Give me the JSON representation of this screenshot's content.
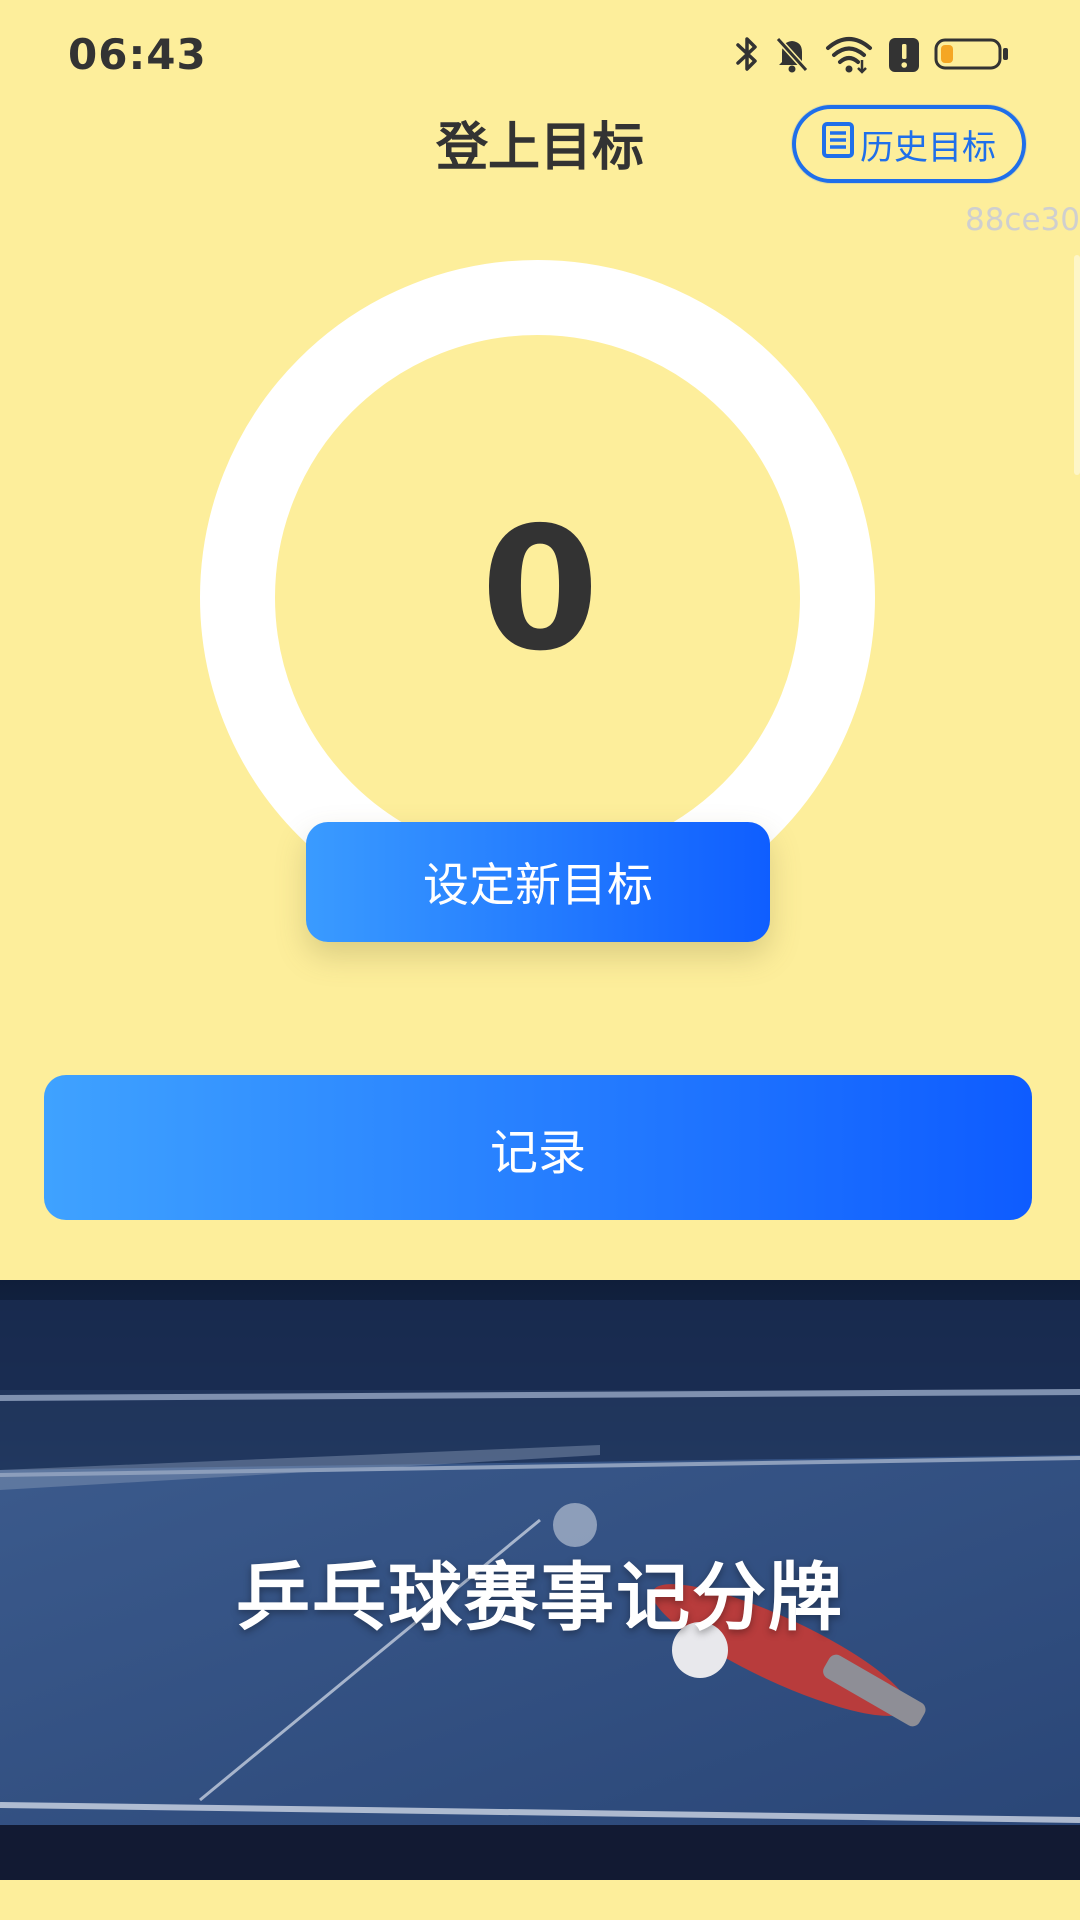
{
  "status_bar": {
    "time": "06:43",
    "icons": [
      "bluetooth-icon",
      "bell-off-icon",
      "wifi-icon",
      "alert-icon",
      "battery-icon"
    ],
    "battery_color": "#F5A623"
  },
  "header": {
    "title": "登上目标",
    "history_button_label": "历史目标",
    "version": "88ce30"
  },
  "goal": {
    "current_value": "0",
    "progress": 0,
    "set_goal_label": "设定新目标"
  },
  "record": {
    "label": "记录"
  },
  "banner": {
    "title": "乒乓球赛事记分牌"
  },
  "colors": {
    "background": "#FDEE9B",
    "accent_blue": "#1F6FEA",
    "ring": "#FFFFFF",
    "text": "#333333"
  }
}
